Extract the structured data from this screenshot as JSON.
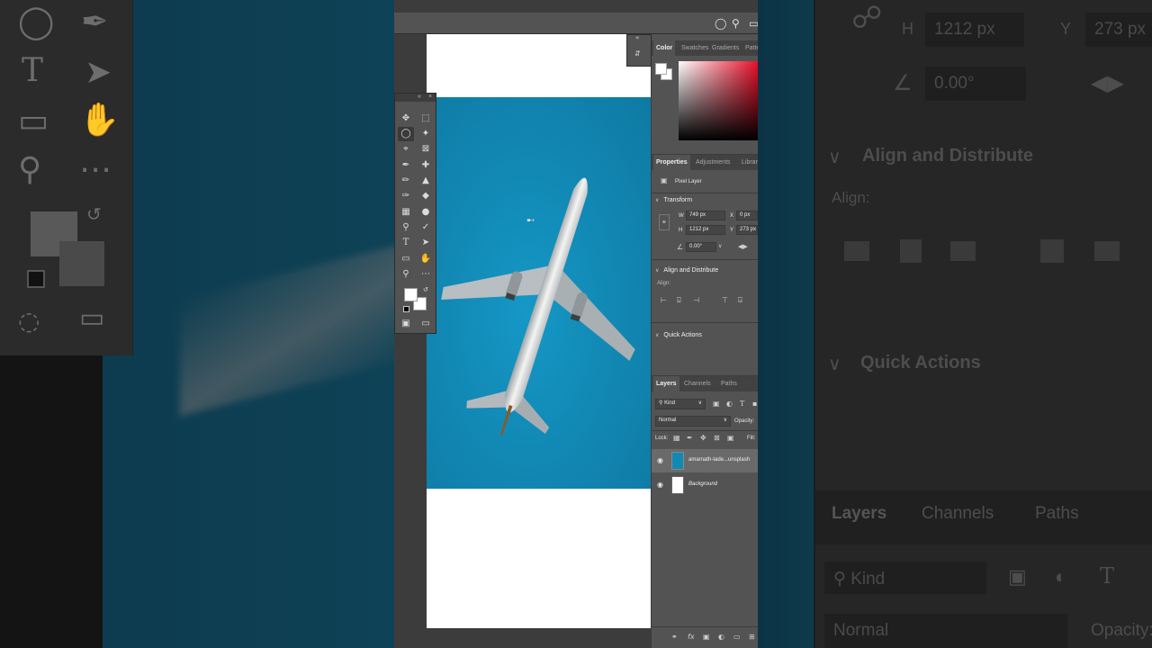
{
  "background_left": {
    "type_tool_glyph": "T"
  },
  "background_right": {
    "h_label": "H",
    "h_value": "1212 px",
    "y_label": "Y",
    "y_value": "273 px",
    "angle_value": "0.00°",
    "align_distribute": "Align and Distribute",
    "align": "Align:",
    "quick_actions": "Quick Actions",
    "layers_tab": "Layers",
    "channels_tab": "Channels",
    "paths_tab": "Paths",
    "kind": "Kind",
    "normal": "Normal",
    "opacity": "Opacity:"
  },
  "toolbar": {
    "type_glyph": "T"
  },
  "color_panel": {
    "tabs": [
      "Color",
      "Swatches",
      "Gradients",
      "Patte"
    ],
    "hue_color": "#e8102a"
  },
  "properties_panel": {
    "tabs": [
      "Properties",
      "Adjustments",
      "Librar"
    ],
    "layer_kind": "Pixel Layer",
    "transform": "Transform",
    "w_label": "W",
    "w_value": "749 px",
    "x_label": "X",
    "x_value": "0 px",
    "h_label": "H",
    "h_value": "1212 px",
    "y_label": "Y",
    "y_value": "273 px",
    "angle_value": "0.00°",
    "align_distribute": "Align and Distribute",
    "align": "Align:",
    "quick_actions": "Quick Actions"
  },
  "layers_panel": {
    "tabs": [
      "Layers",
      "Channels",
      "Paths"
    ],
    "filter": "Kind",
    "blend_mode": "Normal",
    "opacity_label": "Opacity:",
    "lock_label": "Lock:",
    "fill_label": "Fill:",
    "layers": [
      {
        "name": "amarnath-tade...unsplash",
        "selected": true
      },
      {
        "name": "Background",
        "selected": false
      }
    ]
  },
  "colors": {
    "sky": "#1289b5",
    "panel": "#535353",
    "app_bg": "#3c3c3c"
  }
}
